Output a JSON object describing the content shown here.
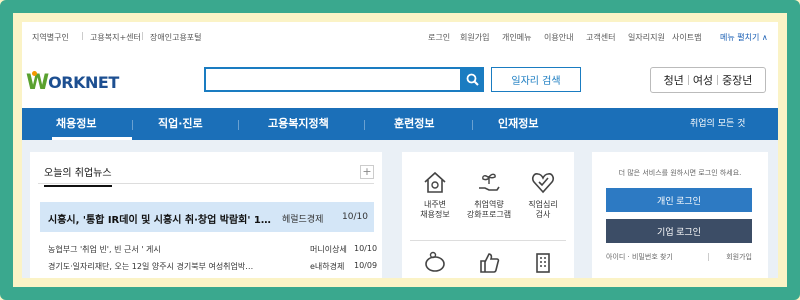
{
  "utility": {
    "left": [
      "지역별구인",
      "고용복지+센터",
      "장애인고용포털"
    ],
    "right": [
      "로그인",
      "회원가입",
      "개인메뉴",
      "이용안내",
      "고객센터",
      "일자리지원",
      "사이트맵"
    ],
    "menu_toggle": "메뉴 펼치기 ∧"
  },
  "logo": {
    "first": "W",
    "rest": "ORKNET"
  },
  "search": {
    "value": "",
    "placeholder": ""
  },
  "job_search_label": "일자리 검색",
  "audience": [
    "청년",
    "여성",
    "중장년"
  ],
  "gnb": {
    "items": [
      "채용정보",
      "직업·진로",
      "고용복지정책",
      "훈련정보",
      "인재정보"
    ],
    "all_services": "취업의 모든 것"
  },
  "news": {
    "tab": "오늘의 취업뉴스",
    "more": "+",
    "highlight": {
      "title": "시흥시, '통합 IR데이 및 시흥시 취·창업 박람회' 1…",
      "source": "헤럴드경제",
      "date": "10/10"
    },
    "items": [
      {
        "title": "농협부그 '취업 빈', 빈 근서 ' 게시",
        "source": "머니이상세",
        "date": "10/10"
      },
      {
        "title": "경기도·일자리재단, 오는 12일 양주시 경기북부 여성취업박…",
        "source": "e내하경제",
        "date": "10/09"
      }
    ]
  },
  "services": [
    {
      "icon": "house-icon",
      "label1": "내주변",
      "label2": "채용정보"
    },
    {
      "icon": "sprout-hand-icon",
      "label1": "취업역량",
      "label2": "강화프로그램"
    },
    {
      "icon": "heart-check-icon",
      "label1": "직업심리",
      "label2": "검사"
    },
    {
      "icon": "piggy-bank-icon",
      "label1": "",
      "label2": ""
    },
    {
      "icon": "thumbs-up-icon",
      "label1": "",
      "label2": ""
    },
    {
      "icon": "building-icon",
      "label1": "",
      "label2": ""
    }
  ],
  "login": {
    "message": "더 많은 서비스를 원하시면 로그인 하세요.",
    "personal": "개인 로그인",
    "company": "기업 로그인",
    "find": "아이디 · 비밀번호 찾기",
    "join": "회원가입"
  },
  "colors": {
    "primary": "#1b6fb8",
    "frame": "#3aa88e",
    "highlight": "#d4e6f7",
    "dark_button": "#3c4d66"
  }
}
